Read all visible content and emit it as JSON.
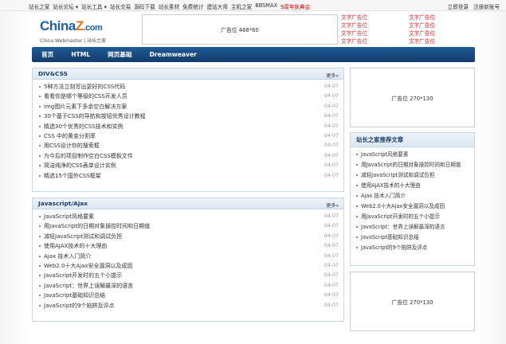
{
  "topbar": {
    "links": [
      "站长之家",
      "站长论坛 ▾",
      "站长工具 ▾",
      "站长交易",
      "源码下载",
      "站长素材",
      "免费统计",
      "建站大师",
      "主机之家",
      "BBSMAX"
    ],
    "hot_link": "9周年庆典会",
    "login": "立即登录",
    "register": "注册新账号"
  },
  "logo": {
    "brand_left": "China",
    "brand_z": "Z",
    "brand_right": ".com",
    "tagline": "China Webmaster | 站长之家"
  },
  "ad_top": "广告位 468*60",
  "text_ads": [
    "文字广告位",
    "文字广告位",
    "文字广告位",
    "文字广告位",
    "文字广告位",
    "文字广告位",
    "文字广告位",
    "文字广告位"
  ],
  "nav": [
    "首页",
    "HTML",
    "网页基础",
    "Dreamweaver"
  ],
  "panel_css": {
    "title": "DIV&CSS",
    "more": "更多»",
    "items": [
      {
        "title": "5种方法立刻写出更好的CSS代码",
        "date": "04-07"
      },
      {
        "title": "看看你是哪个等级的CSS开发人员",
        "date": "04-07"
      },
      {
        "title": "img图片元素下多余空白解决方案",
        "date": "04-07"
      },
      {
        "title": "30个基于CSS的导航和按钮优秀设计教程",
        "date": "04-07"
      },
      {
        "title": "精选30个优秀的CSS技术和实例",
        "date": "04-07"
      },
      {
        "title": "CSS 中的黄金分割率",
        "date": "04-07"
      },
      {
        "title": "用CSS设计你的搜索框",
        "date": "04-07"
      },
      {
        "title": "为今后的项目制作空白CSS模板文件",
        "date": "04-07"
      },
      {
        "title": "简洁纯净的CSS表单设计实例",
        "date": "04-07"
      },
      {
        "title": "精选15个国外CSS框架",
        "date": "04-07"
      }
    ]
  },
  "panel_js": {
    "title": "Javascript/Ajax",
    "more": "更多»",
    "items": [
      {
        "title": "JavaScript风格要素",
        "date": "04-07"
      },
      {
        "title": "用JavaScript的日期对象操控时间和日期值",
        "date": "04-07"
      },
      {
        "title": "减轻JavaScript测试和调试负担",
        "date": "04-07"
      },
      {
        "title": "使用AJAX技术的十大理由",
        "date": "04-07"
      },
      {
        "title": "Ajax 技术入门简介",
        "date": "04-07"
      },
      {
        "title": "Web2.0十大Ajax安全漏洞以及成因",
        "date": "04-07"
      },
      {
        "title": "JavaScript开发时的五个小提示",
        "date": "04-07"
      },
      {
        "title": "JavaScript：世界上误解最深的语言",
        "date": "04-07"
      },
      {
        "title": "JavaScript基础知识总结",
        "date": "04-07"
      },
      {
        "title": "JavaScript的9个陷阱及评点",
        "date": "04-07"
      }
    ]
  },
  "side_ad_1": "广告位 270*130",
  "side_rec": {
    "title": "站长之家推荐文章",
    "items": [
      "JavaScript风格要素",
      "用JavaScript的日期对象操控时间和日期值",
      "减轻JavaScript测试和调试负担",
      "使用AJAX技术的十大理由",
      "Ajax 技术入门简介",
      "Web2.0十大Ajax安全漏洞以及成因",
      "用JavaScript开发时的五个小提示",
      "JavaScript：世界上误解最深的语言",
      "JavaScript基础知识总结",
      "JavaScript的9个陷阱及评点"
    ]
  },
  "side_ad_2": "广告位 270*130"
}
